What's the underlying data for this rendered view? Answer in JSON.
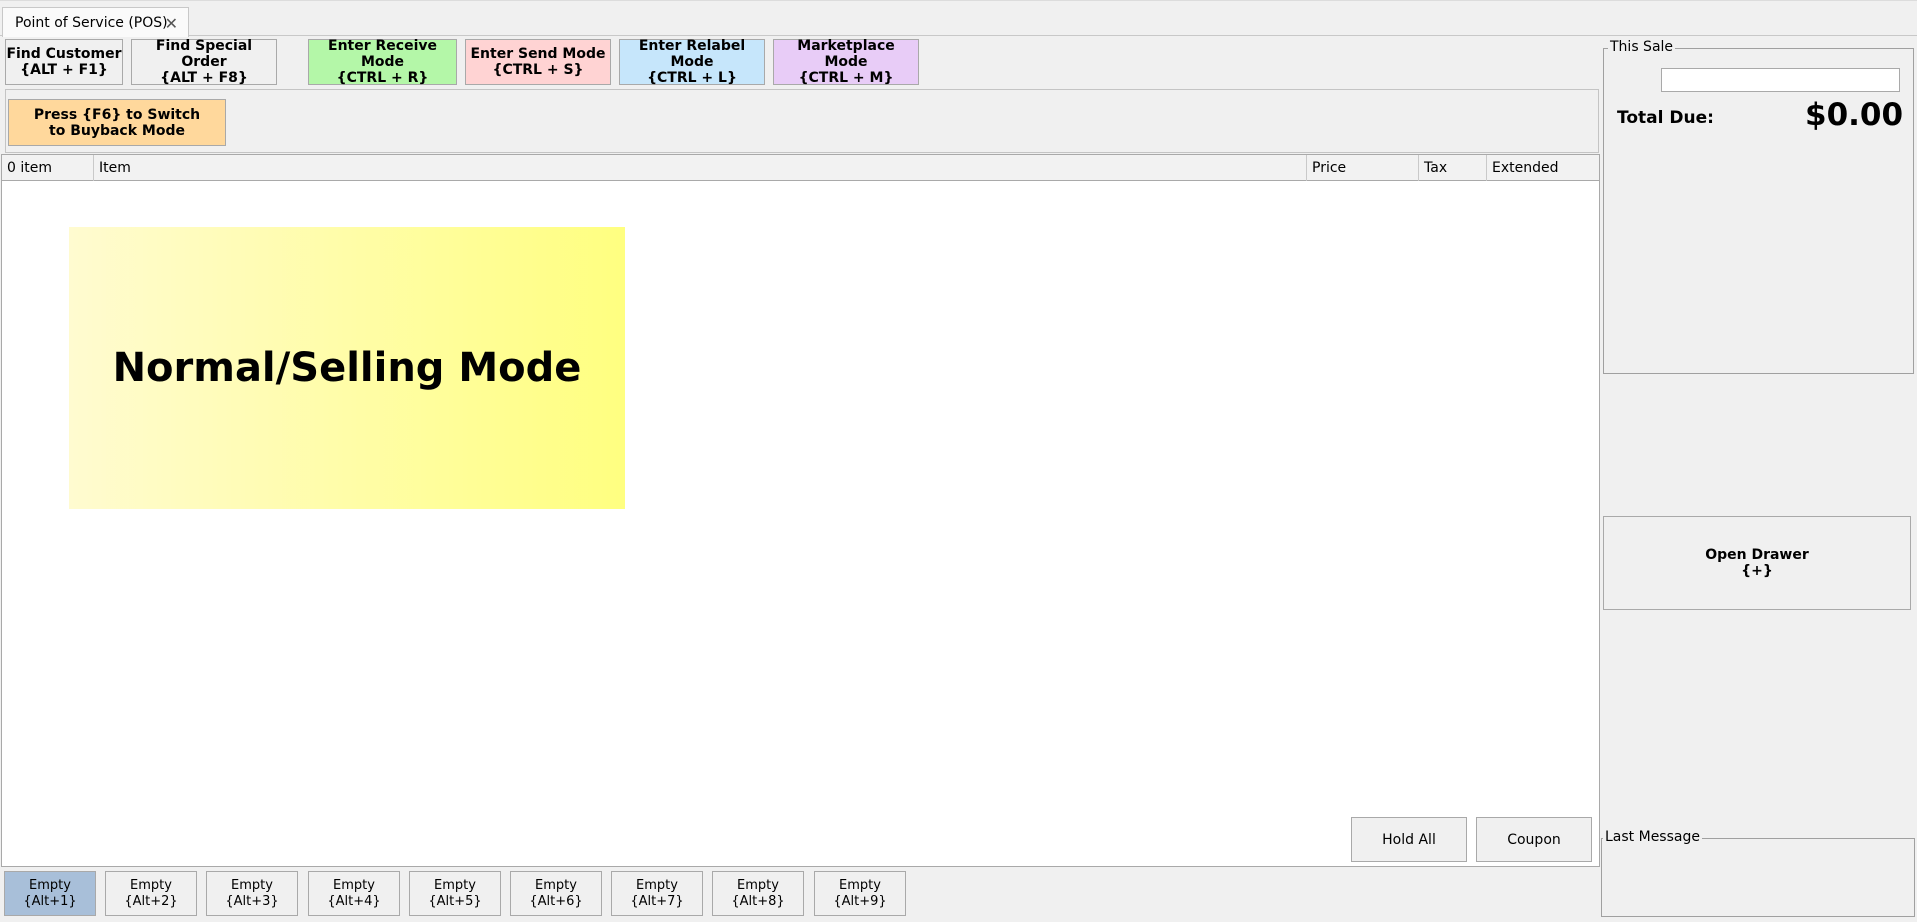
{
  "tab": {
    "title": "Point of Service (POS)",
    "close_icon": "close-icon"
  },
  "toolbar": {
    "find_customer": {
      "line1": "Find Customer",
      "line2": "{ALT + F1}"
    },
    "find_special_order": {
      "line1": "Find Special Order",
      "line2": "{ALT + F8}"
    },
    "receive_mode": {
      "line1": "Enter Receive Mode",
      "line2": "{CTRL + R}",
      "color": "#b4f7a8"
    },
    "send_mode": {
      "line1": "Enter Send Mode",
      "line2": "{CTRL + S}",
      "color": "#ffd3d3"
    },
    "relabel_mode": {
      "line1": "Enter Relabel Mode",
      "line2": "{CTRL + L}",
      "color": "#c6e6fb"
    },
    "marketplace_mode": {
      "line1": "Marketplace Mode",
      "line2": "{CTRL + M}",
      "color": "#e8ccf7"
    }
  },
  "buyback": {
    "line1": "Press {F6} to Switch",
    "line2": "to Buyback Mode",
    "color": "#ffd89c"
  },
  "grid": {
    "columns": [
      "0 item",
      "Item",
      "Price",
      "Tax",
      "Extended"
    ],
    "rows": []
  },
  "mode_banner": {
    "text": "Normal/Selling Mode"
  },
  "actions": {
    "hold_all": "Hold All",
    "coupon": "Coupon"
  },
  "hold_slots": [
    {
      "label": "Empty",
      "shortcut": "{Alt+1}",
      "active": true
    },
    {
      "label": "Empty",
      "shortcut": "{Alt+2}",
      "active": false
    },
    {
      "label": "Empty",
      "shortcut": "{Alt+3}",
      "active": false
    },
    {
      "label": "Empty",
      "shortcut": "{Alt+4}",
      "active": false
    },
    {
      "label": "Empty",
      "shortcut": "{Alt+5}",
      "active": false
    },
    {
      "label": "Empty",
      "shortcut": "{Alt+6}",
      "active": false
    },
    {
      "label": "Empty",
      "shortcut": "{Alt+7}",
      "active": false
    },
    {
      "label": "Empty",
      "shortcut": "{Alt+8}",
      "active": false
    },
    {
      "label": "Empty",
      "shortcut": "{Alt+9}",
      "active": false
    }
  ],
  "this_sale": {
    "title": "This Sale",
    "input_value": "",
    "total_label": "Total Due:",
    "total_value": "$0.00"
  },
  "open_drawer": {
    "line1": "Open Drawer",
    "line2": "{+}"
  },
  "last_message": {
    "title": "Last Message",
    "text": ""
  }
}
